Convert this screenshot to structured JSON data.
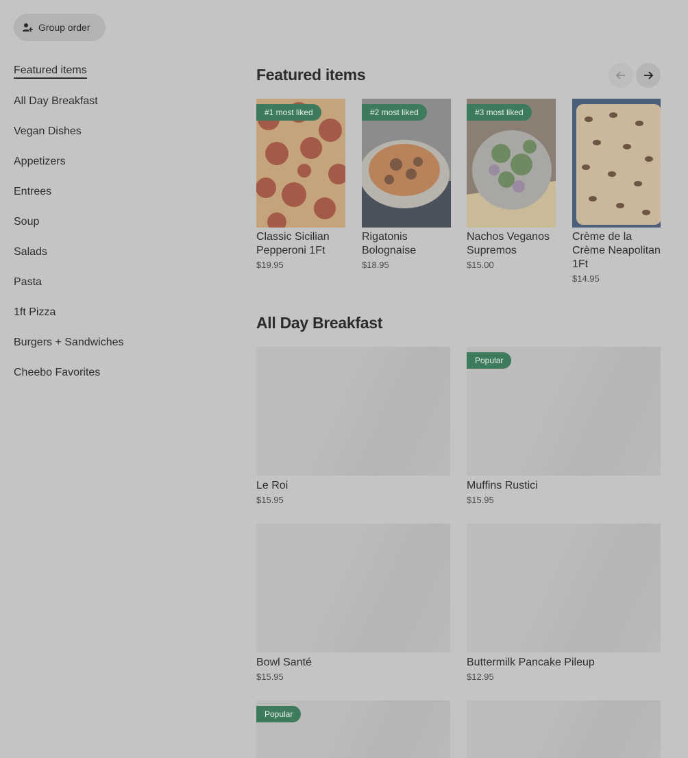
{
  "toolbar": {
    "group_order_label": "Group order"
  },
  "sidebar": {
    "items": [
      {
        "label": "Featured items",
        "active": true
      },
      {
        "label": "All Day Breakfast"
      },
      {
        "label": "Vegan Dishes"
      },
      {
        "label": "Appetizers"
      },
      {
        "label": "Entrees"
      },
      {
        "label": "Soup"
      },
      {
        "label": "Salads"
      },
      {
        "label": "Pasta"
      },
      {
        "label": "1ft Pizza"
      },
      {
        "label": "Burgers + Sandwiches"
      },
      {
        "label": "Cheebo Favorites"
      }
    ]
  },
  "featured": {
    "title": "Featured items",
    "items": [
      {
        "badge": "#1 most liked",
        "name": "Classic Sicilian Pepperoni 1Ft",
        "price": "$19.95"
      },
      {
        "badge": "#2 most liked",
        "name": "Rigatonis Bolognaise",
        "price": "$18.95"
      },
      {
        "badge": "#3 most liked",
        "name": "Nachos Veganos Supremos",
        "price": "$15.00"
      },
      {
        "badge": "",
        "name": "Crème de la Crème Neapolitan 1Ft",
        "price": "$14.95"
      }
    ]
  },
  "breakfast": {
    "title": "All Day Breakfast",
    "items": [
      {
        "badge": "",
        "name": "Le Roi",
        "price": "$15.95"
      },
      {
        "badge": "Popular",
        "name": "Muffins Rustici",
        "price": "$15.95"
      },
      {
        "badge": "",
        "name": "Bowl Santé",
        "price": "$15.95"
      },
      {
        "badge": "",
        "name": "Buttermilk Pancake Pileup",
        "price": "$12.95"
      },
      {
        "badge": "Popular",
        "name": "",
        "price": ""
      },
      {
        "badge": "",
        "name": "",
        "price": ""
      }
    ]
  },
  "colors": {
    "badge_bg": "#3e7a5c",
    "overlay": "#c4c4c4"
  }
}
